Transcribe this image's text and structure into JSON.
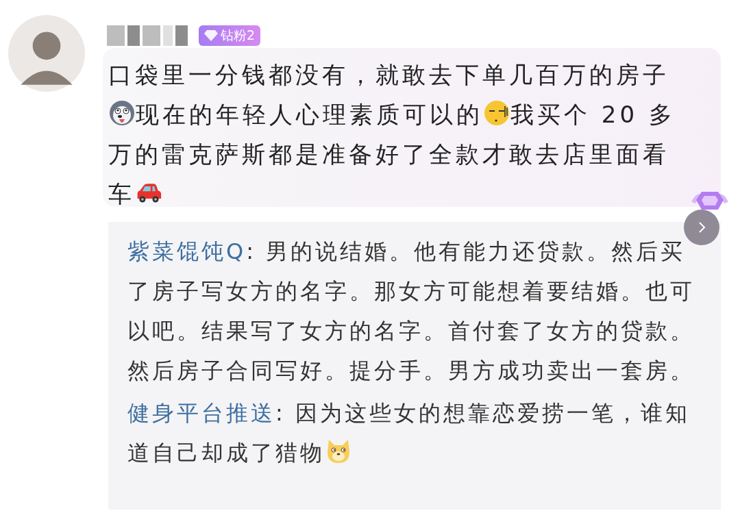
{
  "comment": {
    "badge": "钻粉2",
    "content": [
      {
        "kind": "text",
        "text": "口袋里一分钱都没有，就敢去下单几百万的房子"
      },
      {
        "kind": "husky"
      },
      {
        "kind": "text",
        "text": "现在的年轻人心理素质可以的"
      },
      {
        "kind": "sleepy"
      },
      {
        "kind": "text",
        "text": "我买个 20 多万的雷克萨斯都是准备好了全款才敢去店里面看车"
      },
      {
        "kind": "car"
      }
    ]
  },
  "replies": [
    {
      "author": "紫菜馄饨Q",
      "content": [
        {
          "kind": "text",
          "text": ": 男的说结婚。他有能力还贷款。然后买了房子写女方的名字。那女方可能想着要结婚。也可以吧。结果写了女方的名字。首付套了女方的贷款。然后房子合同写好。提分手。男方成功卖出一套房。"
        }
      ]
    },
    {
      "author": "健身平台推送",
      "content": [
        {
          "kind": "text",
          "text": ": 因为这些女的想靠恋爱捞一笔，谁知道自己却成了猎物"
        },
        {
          "kind": "doge"
        }
      ]
    }
  ]
}
